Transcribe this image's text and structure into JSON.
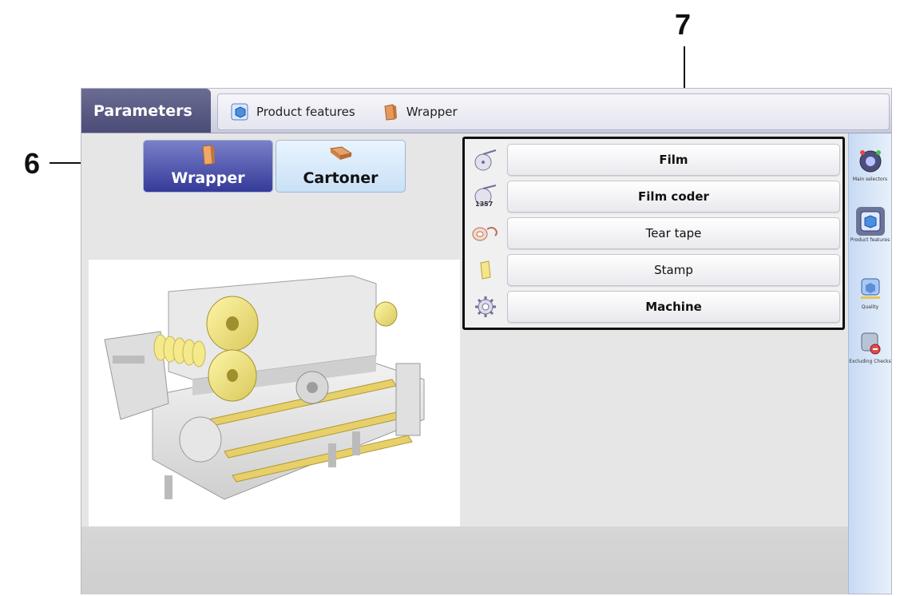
{
  "callouts": {
    "left": "6",
    "right": "7"
  },
  "topbar": {
    "title": "Parameters",
    "breadcrumbs": [
      {
        "label": "Product features",
        "icon": "product-features-icon"
      },
      {
        "label": "Wrapper",
        "icon": "wrapper-icon"
      }
    ]
  },
  "product_tabs": [
    {
      "label": "Wrapper",
      "icon": "wrapper-icon",
      "selected": true
    },
    {
      "label": "Cartoner",
      "icon": "cartoner-icon",
      "selected": false
    }
  ],
  "features": [
    {
      "label": "Film",
      "icon": "film-icon"
    },
    {
      "label": "Film coder",
      "icon": "film-coder-icon",
      "icon_text": "1357"
    },
    {
      "label": "Tear tape",
      "icon": "tear-tape-icon"
    },
    {
      "label": "Stamp",
      "icon": "stamp-icon"
    },
    {
      "label": "Machine",
      "icon": "machine-gear-icon"
    }
  ],
  "sidebar": [
    {
      "label": "Main selectors",
      "icon": "main-selectors-icon"
    },
    {
      "label": "Product features",
      "icon": "product-features-icon",
      "active": true
    },
    {
      "label": "Quality",
      "icon": "quality-icon"
    },
    {
      "label": "Excluding Checks",
      "icon": "excluding-checks-icon"
    }
  ],
  "colors": {
    "title_bg": "#4b4c77",
    "selected_tab": "#353a99",
    "unselected_tab": "#c9e1f6",
    "sidebar_bg": "#c7daf4"
  }
}
